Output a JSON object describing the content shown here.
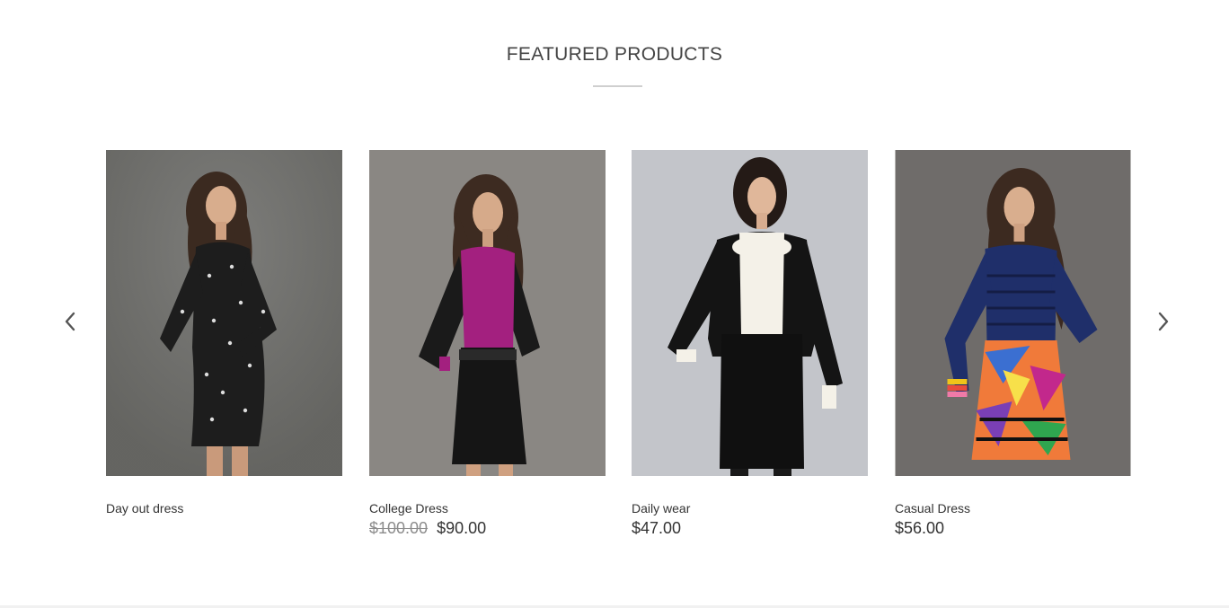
{
  "section": {
    "title": "FEATURED PRODUCTS"
  },
  "carousel": {
    "prev_icon": "chevron-left-icon",
    "next_icon": "chevron-right-icon"
  },
  "products": [
    {
      "name": "Day out dress",
      "old_price": "",
      "price": "",
      "image": "model in black star-print lace mini dress",
      "bg": "#6d6d6b",
      "outfit": "#1d1d1d",
      "accent": "#ffffff"
    },
    {
      "name": "College Dress",
      "old_price": "$100.00",
      "price": "$90.00",
      "image": "model in magenta blouse with black skirt",
      "bg": "#8a8783",
      "outfit": "#151515",
      "accent": "#a3207f"
    },
    {
      "name": "Daily wear",
      "old_price": "",
      "price": "$47.00",
      "image": "model in black blazer with white bow blouse",
      "bg": "#c3c5ca",
      "outfit": "#141414",
      "accent": "#f4f1e8"
    },
    {
      "name": "Casual Dress",
      "old_price": "",
      "price": "$56.00",
      "image": "model in navy top with colorful print skirt",
      "bg": "#6f6c6a",
      "outfit": "#1f2f6a",
      "accent": "#f07a3a"
    }
  ]
}
